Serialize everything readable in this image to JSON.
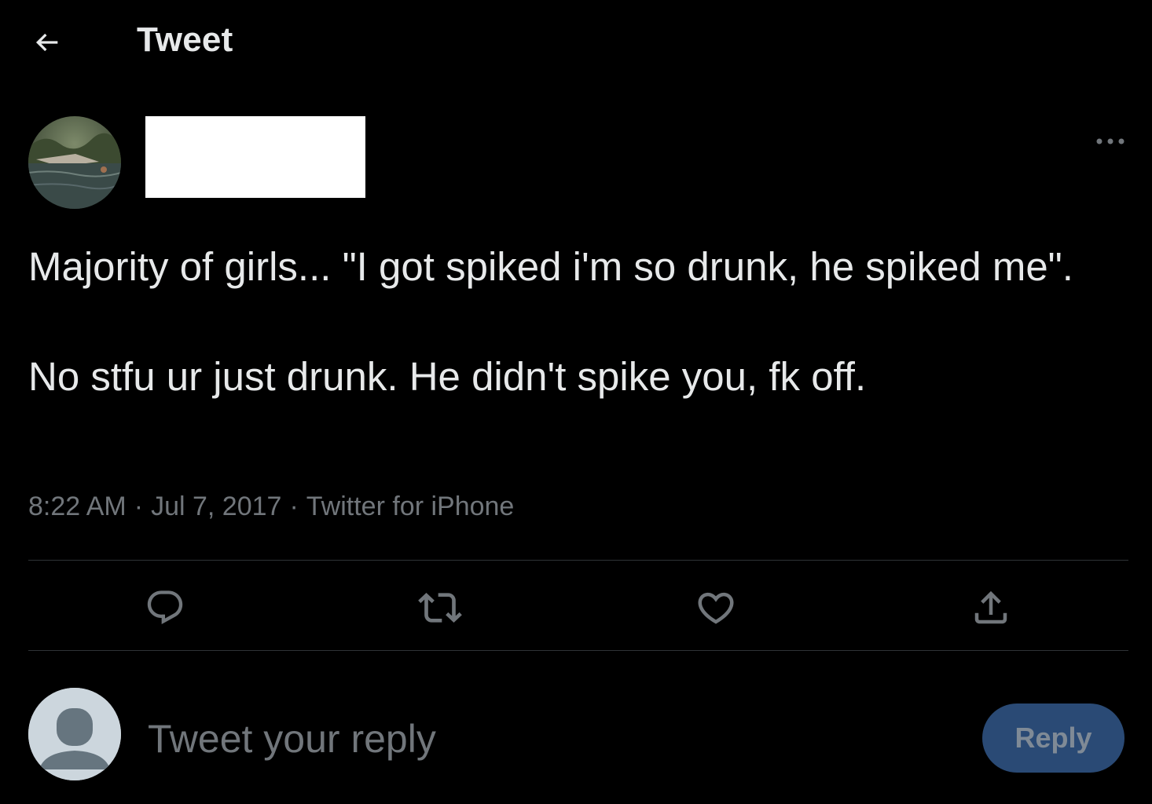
{
  "header": {
    "title": "Tweet",
    "back_icon": "arrow-left-icon"
  },
  "tweet": {
    "author_avatar": "avatar-photo",
    "more_icon": "more-icon",
    "text": "Majority of girls... \"I got spiked i'm so drunk, he spiked me\".\n\nNo stfu ur just drunk. He didn't spike you, fk off.",
    "time": "8:22 AM",
    "date": "Jul 7, 2017",
    "source": "Twitter for iPhone",
    "separator": "·"
  },
  "actions": {
    "icons": [
      "reply-icon",
      "retweet-icon",
      "like-icon",
      "share-icon"
    ]
  },
  "reply_box": {
    "placeholder": "Tweet your reply",
    "button_label": "Reply",
    "button_color": "#2a4a75"
  },
  "colors": {
    "background": "#000000",
    "text": "#e7e9ea",
    "secondary_text": "#71767b",
    "divider": "#2f3336"
  }
}
